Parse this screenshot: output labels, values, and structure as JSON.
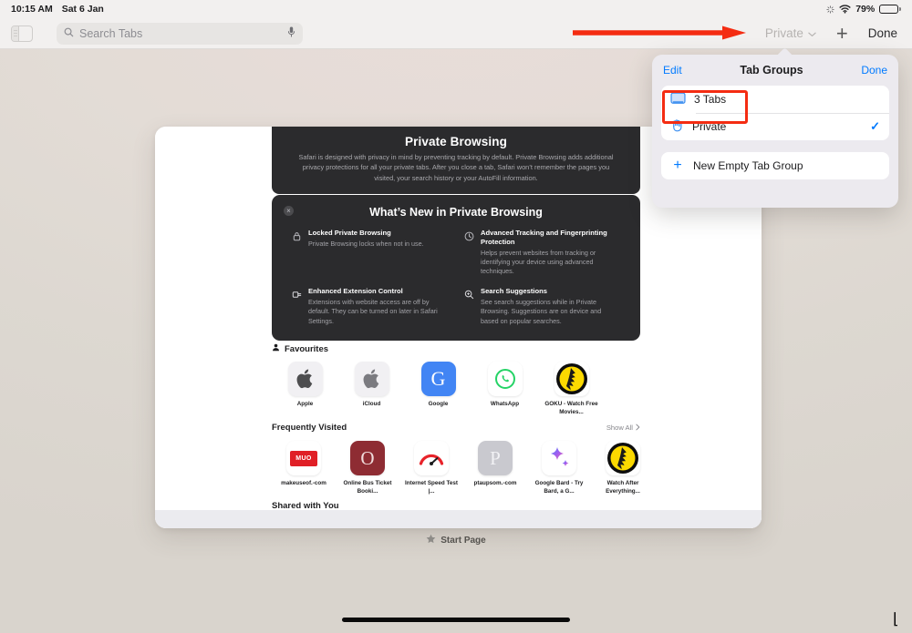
{
  "status_bar": {
    "time": "10:15 AM",
    "date": "Sat 6 Jan",
    "battery_percent": "79%",
    "battery_level": 79,
    "icons": [
      "brightness-icon",
      "wifi-icon",
      "battery-icon"
    ]
  },
  "toolbar": {
    "sidebar_toggle_icon": "sidebar-icon",
    "search": {
      "placeholder": "Search Tabs",
      "value": "",
      "icon": "search-icon",
      "mic_icon": "microphone-icon"
    },
    "tab_group_label": "Private",
    "tab_group_chevron": "⌄",
    "new_tab_label": "+",
    "done_label": "Done"
  },
  "annotation": {
    "arrow_color": "#f42c12",
    "highlight_color": "#f42c12"
  },
  "tab_card": {
    "private_banner": {
      "title": "Private Browsing",
      "body": "Safari is designed with privacy in mind by preventing tracking by default. Private Browsing adds additional privacy protections for all your private tabs. After you close a tab, Safari won’t remember the pages you visited, your search history or your AutoFill information."
    },
    "whats_new": {
      "title": "What’s New in Private Browsing",
      "close_label": "×",
      "features": [
        {
          "icon": "lock-icon",
          "title": "Locked Private Browsing",
          "desc": "Private Browsing locks when not in use."
        },
        {
          "icon": "clock-icon",
          "title": "Advanced Tracking and Fingerprinting Protection",
          "desc": "Helps prevent websites from tracking or identifying your device using advanced techniques."
        },
        {
          "icon": "extension-icon",
          "title": "Enhanced Extension Control",
          "desc": "Extensions with website access are off by default. They can be turned on later in Safari Settings."
        },
        {
          "icon": "search-plus-icon",
          "title": "Search Suggestions",
          "desc": "See search suggestions while in Private Browsing. Suggestions are on device and based on popular searches."
        }
      ]
    },
    "favourites": {
      "heading": "Favourites",
      "heading_icon": "person-icon",
      "items": [
        {
          "label": "Apple",
          "icon": "apple-logo"
        },
        {
          "label": "iCloud",
          "icon": "apple-logo"
        },
        {
          "label": "Google",
          "icon": "google-g"
        },
        {
          "label": "WhatsApp",
          "icon": "whatsapp-logo"
        },
        {
          "label": "GOKU - Watch Free Movies...",
          "icon": "goku-logo"
        }
      ]
    },
    "frequently_visited": {
      "heading": "Frequently Visited",
      "show_all_label": "Show All",
      "show_all_icon": "chevron-right-icon",
      "items": [
        {
          "label": "makeuseof.-com",
          "icon": "muo-logo"
        },
        {
          "label": "Online Bus Ticket Booki...",
          "icon": "letter-o-logo"
        },
        {
          "label": "Internet Speed Test |...",
          "icon": "speedtest-logo"
        },
        {
          "label": "ptaupsom.-com",
          "icon": "letter-p-logo"
        },
        {
          "label": "Google Bard - Try Bard, a G...",
          "icon": "bard-spark-logo"
        },
        {
          "label": "Watch After Everything...",
          "icon": "goku-logo"
        }
      ]
    },
    "shared_with_you": {
      "heading": "Shared with You"
    }
  },
  "start_page": {
    "label": "Start Page",
    "icon": "star-icon"
  },
  "popover": {
    "edit_label": "Edit",
    "title": "Tab Groups",
    "done_label": "Done",
    "groups": [
      {
        "label": "3 Tabs",
        "icon": "tabs-icon",
        "selected": false,
        "highlighted": true
      },
      {
        "label": "Private",
        "icon": "hand-icon",
        "selected": true,
        "check": "✓",
        "highlighted": false
      }
    ],
    "new_group": {
      "label": "New Empty Tab Group",
      "icon": "plus-icon"
    }
  }
}
